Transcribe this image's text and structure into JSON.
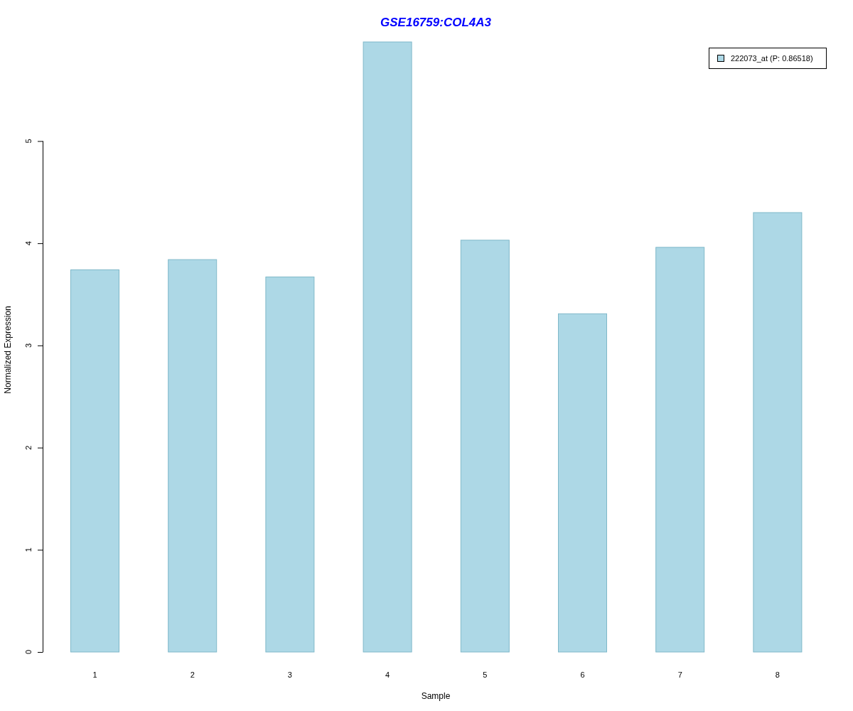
{
  "chart_data": {
    "type": "bar",
    "title": "GSE16759:COL4A3",
    "xlabel": "Sample",
    "ylabel": "Normalized Expression",
    "categories": [
      "1",
      "2",
      "3",
      "4",
      "5",
      "6",
      "7",
      "8"
    ],
    "series": [
      {
        "name": "222073_at (P: 0.86518)",
        "color": "#add8e6",
        "values": [
          3.74,
          3.84,
          3.67,
          5.97,
          4.03,
          3.31,
          3.96,
          4.3
        ]
      }
    ],
    "ylim": [
      0,
      5.97
    ],
    "yticks": [
      0,
      1,
      2,
      3,
      4,
      5
    ]
  }
}
